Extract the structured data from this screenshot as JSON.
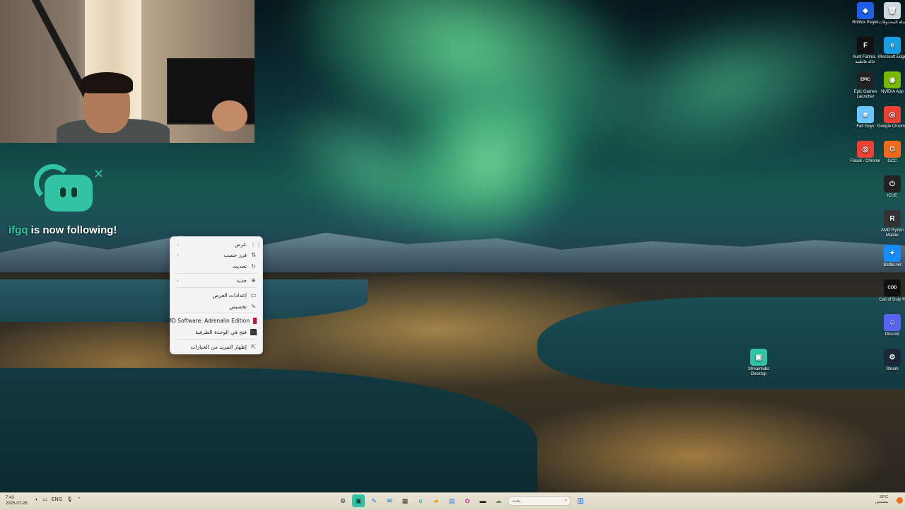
{
  "follow_alert": {
    "username": "ifgq",
    "message": " is now following!"
  },
  "context_menu": {
    "items": [
      {
        "label": "عرض",
        "icon": "grid-icon",
        "glyph": "⋮⋮",
        "submenu": true
      },
      {
        "label": "فرز حسب",
        "icon": "sort-icon",
        "glyph": "⇅",
        "submenu": true
      },
      {
        "label": "تحديث",
        "icon": "refresh-icon",
        "glyph": "↻",
        "submenu": false
      },
      {
        "label": "جديد",
        "icon": "new-icon",
        "glyph": "⊕",
        "submenu": true
      },
      {
        "label": "إعدادات العرض",
        "icon": "display-settings-icon",
        "glyph": "▭",
        "submenu": false
      },
      {
        "label": "تخصيص",
        "icon": "personalize-icon",
        "glyph": "✎",
        "submenu": false
      },
      {
        "label": "AMD Software: Adrenalin Edition",
        "icon": "amd-icon",
        "glyph": "a",
        "submenu": false
      },
      {
        "label": "فتح في الوحدة الطرفية",
        "icon": "terminal-icon",
        "glyph": ">_",
        "submenu": false
      },
      {
        "label": "إظهار المزيد من الخيارات",
        "icon": "more-options-icon",
        "glyph": "⇱",
        "submenu": false
      }
    ]
  },
  "desktop_icons": [
    {
      "label": "Roblox Player",
      "icon": "roblox-icon",
      "color": "#1f5ee8",
      "glyph": "◆"
    },
    {
      "label": "سلة المحذوفات",
      "icon": "recycle-bin-icon",
      "color": "#cfd8dc",
      "glyph": "🗑"
    },
    {
      "label": "Aunt Fatima - خالة فاطمة",
      "icon": "aunt-fatima-icon",
      "color": "#111111",
      "glyph": "F"
    },
    {
      "label": "Microsoft Edge",
      "icon": "edge-icon",
      "color": "#1b9de2",
      "glyph": "e"
    },
    {
      "label": "Epic Games Launcher",
      "icon": "epic-games-icon",
      "color": "#222222",
      "glyph": "EPIC"
    },
    {
      "label": "NVIDIA App",
      "icon": "nvidia-icon",
      "color": "#76b900",
      "glyph": "◉"
    },
    {
      "label": "Fall Guys",
      "icon": "fall-guys-icon",
      "color": "#6ec6ff",
      "glyph": "☻"
    },
    {
      "label": "Google Chrome",
      "icon": "chrome-icon",
      "color": "#e94235",
      "glyph": "◎"
    },
    {
      "label": "Faisal - Chrome",
      "icon": "chrome-profile-icon",
      "color": "#e94235",
      "glyph": "◎"
    },
    {
      "label": "GCC",
      "icon": "gcc-icon",
      "color": "#f26b1d",
      "glyph": "G"
    },
    {
      "label": "iCUE",
      "icon": "icue-icon",
      "color": "#222222",
      "glyph": "⏻"
    },
    {
      "label": "AMD Ryzen Master",
      "icon": "ryzen-master-icon",
      "color": "#333333",
      "glyph": "R"
    },
    {
      "label": "Battle.net",
      "icon": "battlenet-icon",
      "color": "#148eff",
      "glyph": "✦"
    },
    {
      "label": "Call of Duty ®",
      "icon": "call-of-duty-icon",
      "color": "#111111",
      "glyph": "COD"
    },
    {
      "label": "Discord",
      "icon": "discord-icon",
      "color": "#5865f2",
      "glyph": "☺"
    },
    {
      "label": "Steam",
      "icon": "steam-icon",
      "color": "#1b2838",
      "glyph": "⚙"
    },
    {
      "label": "Streamlabs Desktop",
      "icon": "streamlabs-icon",
      "color": "#31c3a2",
      "glyph": "▣"
    }
  ],
  "taskbar": {
    "time": "7:43",
    "date": "2025-07-28",
    "language": "ENG",
    "search_placeholder": "بحث",
    "weather_temp": "33°C",
    "weather_desc": "مشمس",
    "accent": "#e9e5d7"
  }
}
